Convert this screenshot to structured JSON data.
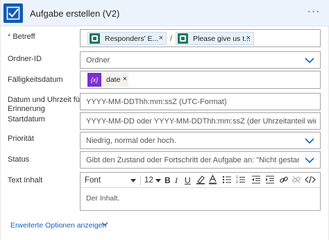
{
  "header": {
    "title": "Aufgabe erstellen (V2)",
    "more_label": "···"
  },
  "fields": {
    "betreff": {
      "required_mark": "*",
      "label": "Betreff",
      "tokens": [
        {
          "label": "Responders' E...",
          "close": "×"
        },
        {
          "label": "Please give us t...",
          "close": "×"
        }
      ],
      "separator": "/"
    },
    "ordner": {
      "label": "Ordner-ID",
      "value": "Ordner"
    },
    "faelligkeit": {
      "label": "Fälligkeitsdatum",
      "token": {
        "icon_text": "{x}",
        "label": "date",
        "close": "×"
      }
    },
    "erinnerung": {
      "label_line1": "Datum und Uhrzeit für",
      "label_line2": "Erinnerung",
      "placeholder": "YYYY-MM-DDThh:mm:ssZ (UTC-Format)"
    },
    "startdatum": {
      "label": "Startdatum",
      "placeholder": "YYYY-MM-DD oder YYYY-MM-DDThh:mm:ssZ (der Uhrzeitanteil wird ignoriert)"
    },
    "prioritaet": {
      "label": "Priorität",
      "placeholder": "Niedrig, normal oder hoch."
    },
    "status": {
      "label": "Status",
      "placeholder": "Gibt den Zustand oder Fortschritt der Aufgabe an: \"Nicht gestartet\", \"In B"
    },
    "text_inhalt": {
      "label": "Text Inhalt",
      "font_label": "Font",
      "size_label": "12",
      "body_placeholder": "Der Inhalt."
    }
  },
  "advanced_options": "Erweiterte Optionen anzeigen",
  "colors": {
    "header_bg": "#edf3fc",
    "app_icon": "#0f5bb5",
    "accent_link": "#0f62c3",
    "dynamic_token_icon": "#1f7a5b",
    "expression_icon": "#7c2fd0",
    "required": "#c4262e"
  },
  "icons": [
    "checkbox-task-icon",
    "more-icon",
    "chevron-down-icon",
    "forms-icon",
    "expression-icon",
    "bold-icon",
    "italic-icon",
    "underline-icon",
    "highlight-icon",
    "font-color-icon",
    "bulleted-list-icon",
    "numbered-list-icon",
    "link-icon",
    "unlink-icon",
    "code-view-icon"
  ]
}
